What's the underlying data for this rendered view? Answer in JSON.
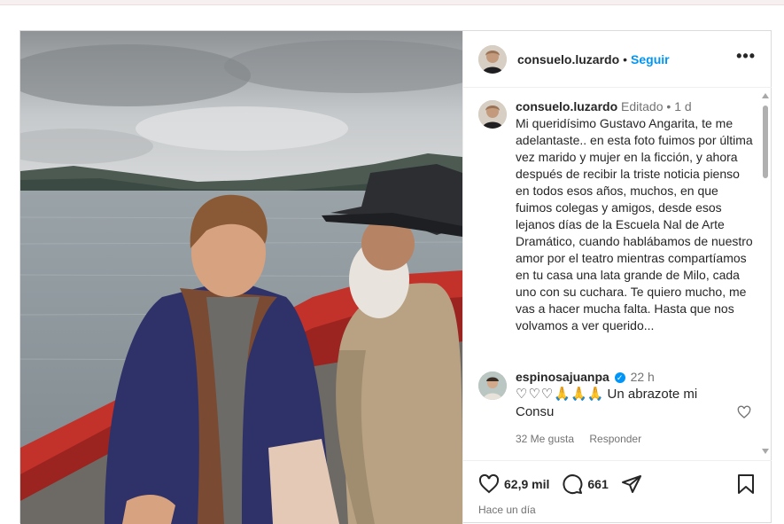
{
  "post": {
    "username": "consuelo.luzardo",
    "separator": "•",
    "follow_label": "Seguir",
    "more_label": "•••"
  },
  "caption": {
    "username": "consuelo.luzardo",
    "edited": "Editado",
    "separator": "•",
    "age": "1 d",
    "text": "Mi queridísimo Gustavo Angarita, te me adelantaste.. en esta foto fuimos por última vez marido y mujer en la ficción, y ahora después de recibir la triste noticia pienso en todos esos años, muchos, en que fuimos colegas y amigos, desde esos lejanos días de la Escuela Nal de Arte Dramático, cuando hablábamos de nuestro amor por el teatro mientras compartíamos en tu casa una lata grande de Milo, cada uno con su cuchara.  Te quiero mucho, me vas a hacer mucha falta.  Hasta que nos volvamos a ver querido..."
  },
  "comment": {
    "username": "espinosajuanpa",
    "age": "22 h",
    "hearts": "♡♡♡",
    "prayers": "🙏🙏🙏",
    "text": "Un abrazote mi Consu",
    "likes": "32 Me gusta",
    "reply_label": "Responder"
  },
  "stats": {
    "likes": "62,9 mil",
    "comments": "661",
    "time": "Hace un día"
  },
  "colors": {
    "link": "#0095f6",
    "muted": "#737373",
    "border": "#dbdbdb"
  },
  "icons": [
    "heart-icon",
    "comment-icon",
    "share-icon",
    "bookmark-icon",
    "verified-icon",
    "more-icon"
  ]
}
